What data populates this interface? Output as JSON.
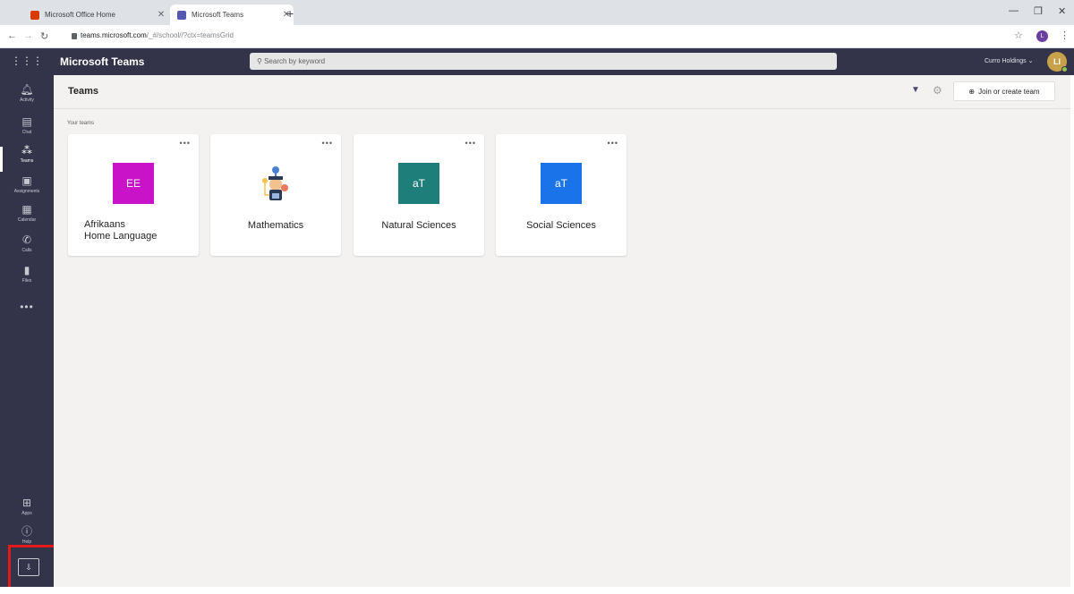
{
  "browser": {
    "tabs": [
      {
        "title": "Microsoft Office Home",
        "favicon_color": "#d83b01",
        "active": false
      },
      {
        "title": "Microsoft Teams",
        "favicon_color": "#5558af",
        "active": true
      }
    ],
    "url_host": "teams.microsoft.com",
    "url_path": "/_#/school//?ctx=teamsGrid",
    "profile_initial": "L"
  },
  "header": {
    "app_title": "Microsoft Teams",
    "search_placeholder": "Search by keyword",
    "org_name": "Curro Holdings",
    "avatar_initials": "LI"
  },
  "rail": {
    "items": [
      {
        "label": "Activity",
        "icon": "bell-icon"
      },
      {
        "label": "Chat",
        "icon": "chat-icon"
      },
      {
        "label": "Teams",
        "icon": "teams-icon",
        "active": true
      },
      {
        "label": "Assignments",
        "icon": "assignments-icon"
      },
      {
        "label": "Calendar",
        "icon": "calendar-icon"
      },
      {
        "label": "Calls",
        "icon": "phone-icon"
      },
      {
        "label": "Files",
        "icon": "file-icon"
      }
    ],
    "more": "•••",
    "bottom": [
      {
        "label": "Apps",
        "icon": "apps-icon"
      },
      {
        "label": "Help",
        "icon": "help-icon"
      }
    ]
  },
  "main": {
    "title": "Teams",
    "join_label": "Join or create team",
    "section_label": "Your teams",
    "teams": [
      {
        "name_line1": "Afrikaans",
        "name_line2": "Home Language",
        "tile_text": "EE",
        "tile_color": "#c813c8"
      },
      {
        "name_line1": "Mathematics",
        "tile_text": "",
        "tile_color": ""
      },
      {
        "name_line1": "Natural Sciences",
        "tile_text": "aT",
        "tile_color": "#1e7f7a"
      },
      {
        "name_line1": "Social Sciences",
        "tile_text": "aT",
        "tile_color": "#1a73e8"
      }
    ]
  }
}
